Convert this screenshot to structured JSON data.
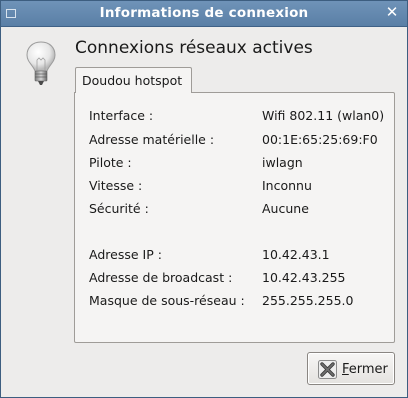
{
  "window": {
    "title": "Informations de connexion",
    "close_glyph": "✕"
  },
  "main": {
    "heading": "Connexions réseaux actives",
    "tab_label": "Doudou hotspot",
    "rows": [
      {
        "label": "Interface :",
        "value": "Wifi 802.11 (wlan0)"
      },
      {
        "label": "Adresse matérielle :",
        "value": "00:1E:65:25:69:F0"
      },
      {
        "label": "Pilote :",
        "value": "iwlagn"
      },
      {
        "label": "Vitesse :",
        "value": "Inconnu"
      },
      {
        "label": "Sécurité :",
        "value": "Aucune"
      },
      {
        "label": "Adresse IP :",
        "value": "10.42.43.1"
      },
      {
        "label": "Adresse de broadcast :",
        "value": "10.42.43.255"
      },
      {
        "label": "Masque de sous-réseau :",
        "value": "255.255.255.0"
      }
    ]
  },
  "buttons": {
    "close_mnemonic": "F",
    "close_rest": "ermer"
  },
  "icons": {
    "window_menu": "window-menu-icon",
    "window_close": "close-icon",
    "bulb": "light-bulb-icon",
    "button_close": "close-x-icon"
  },
  "colors": {
    "titlebar": "#5f84ab",
    "window_bg": "#edeceb",
    "panel_bg": "#f5f4f3",
    "close_icon_red": "#cf2a20"
  }
}
